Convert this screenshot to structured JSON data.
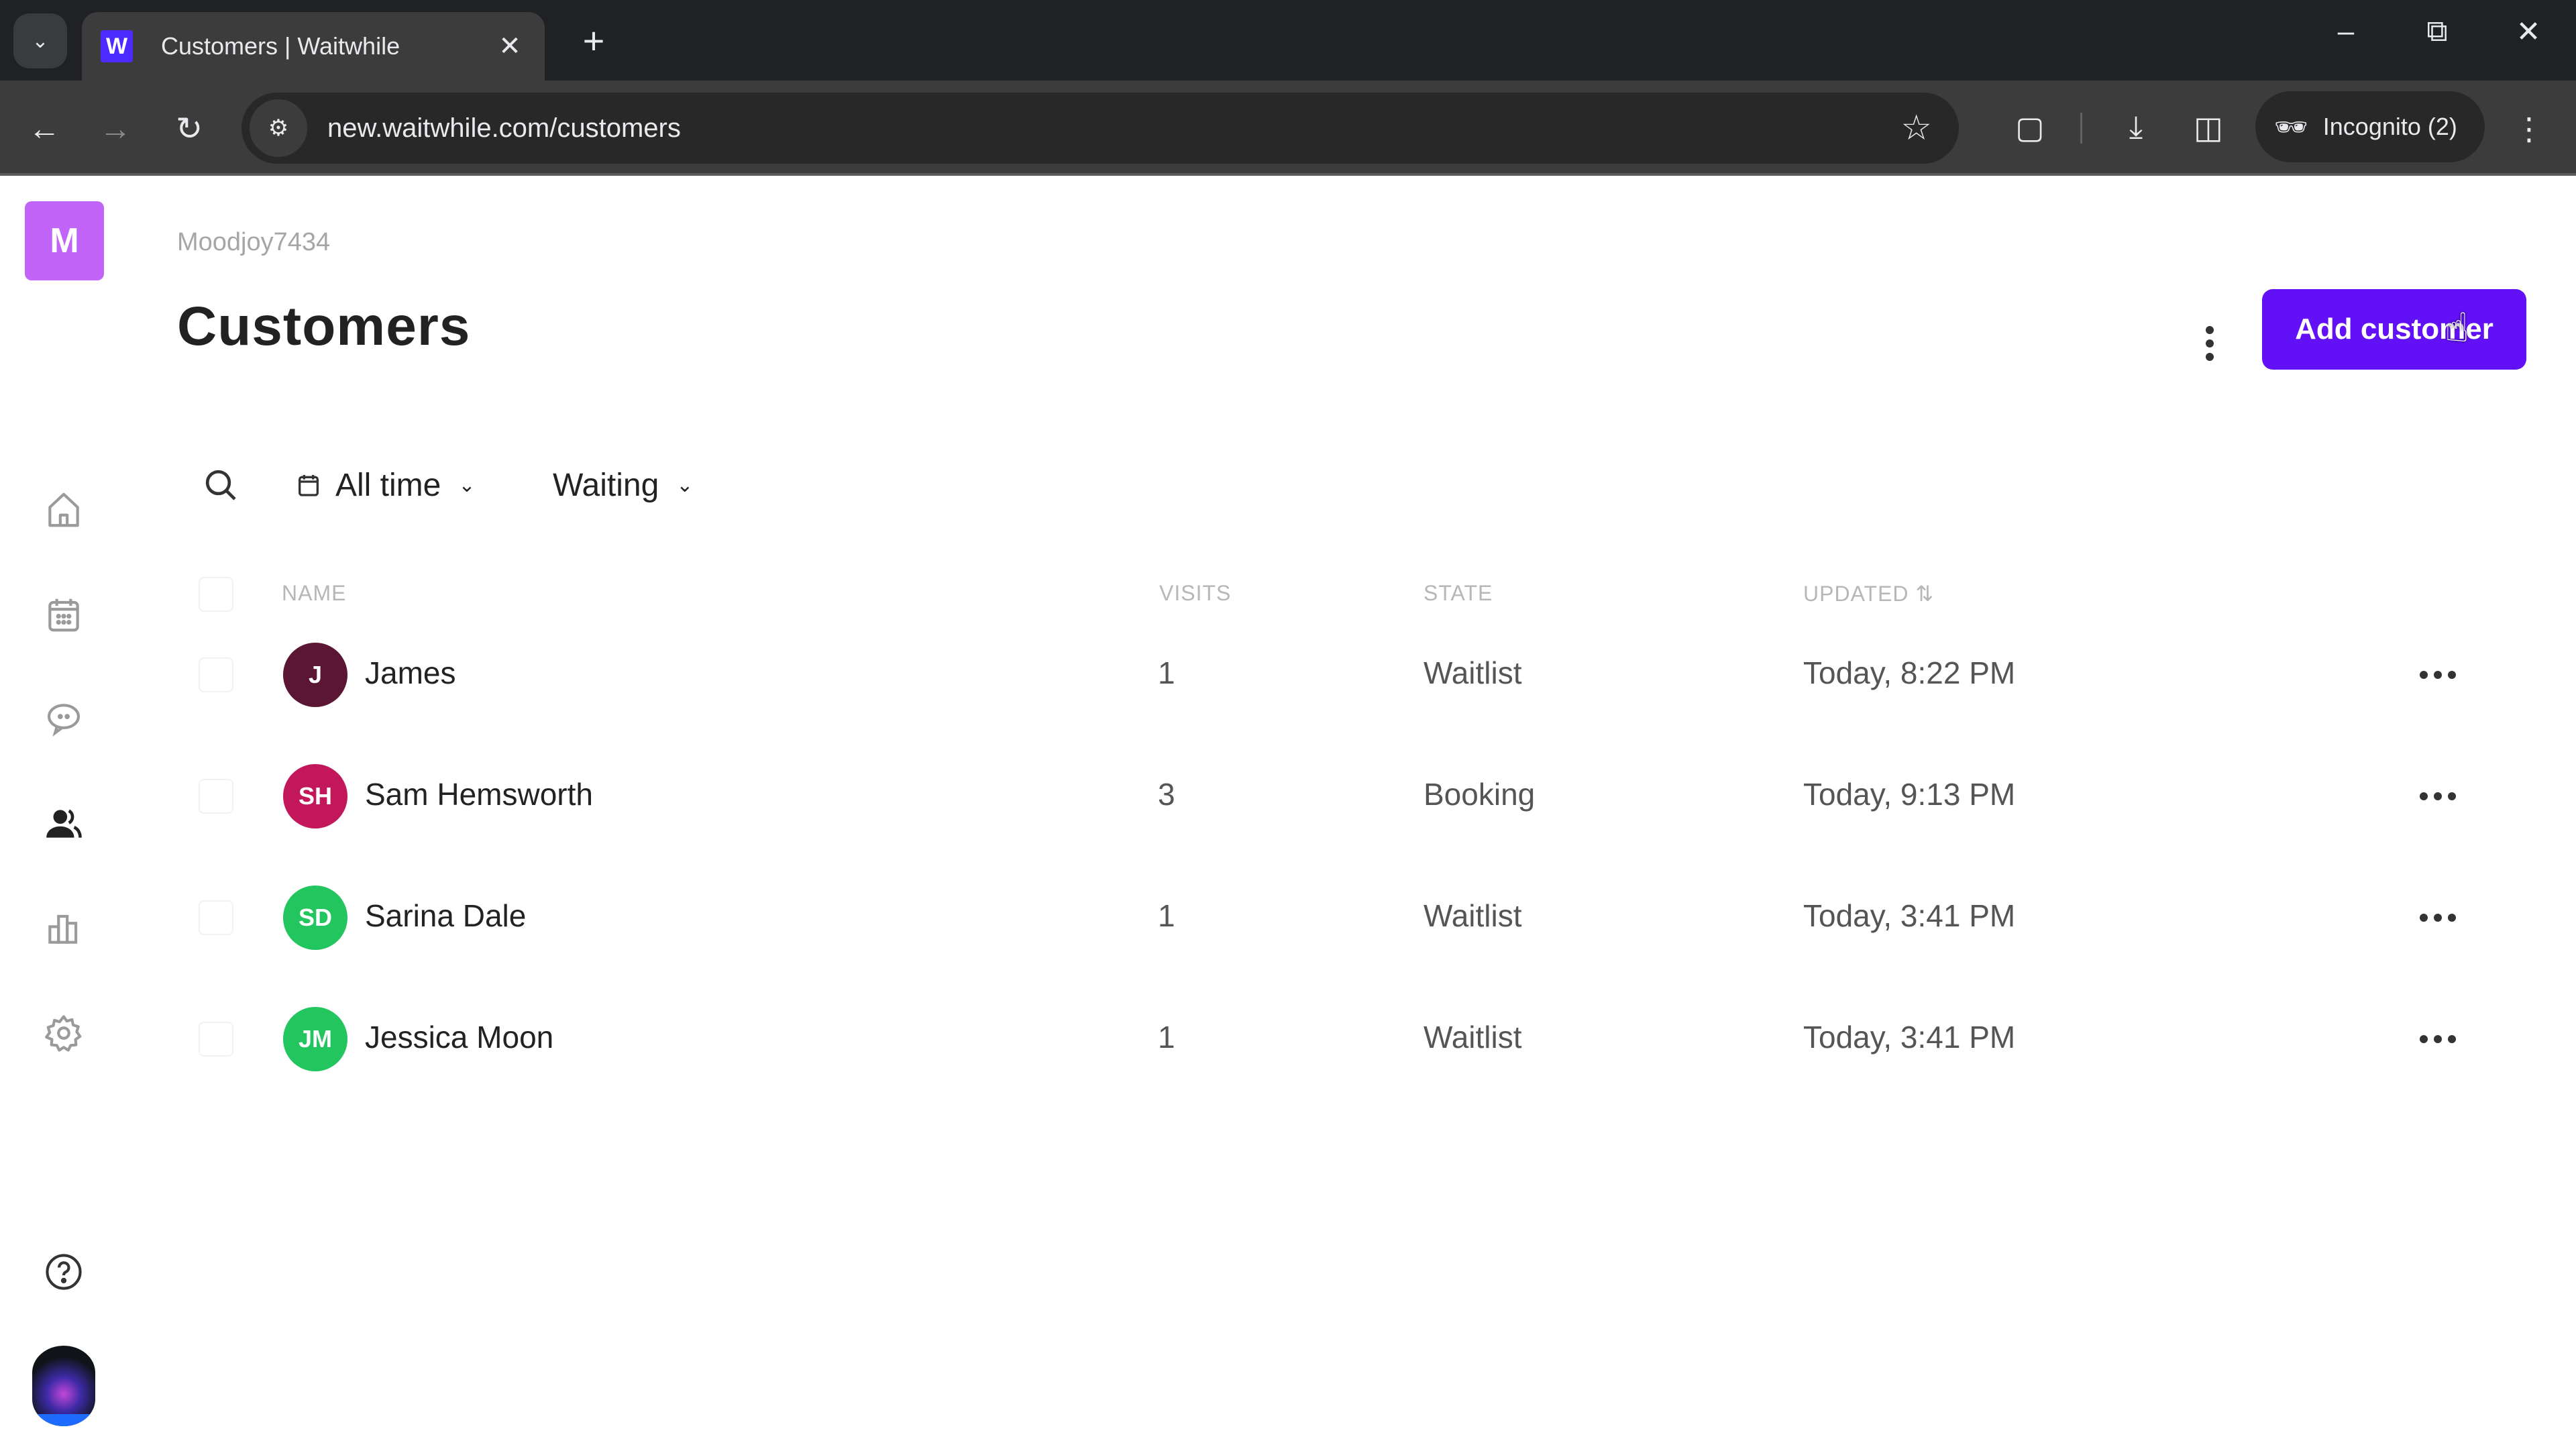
{
  "browser": {
    "tab_title": "Customers | Waitwhile",
    "favicon_letter": "W",
    "url": "new.waitwhile.com/customers",
    "incognito_label": "Incognito (2)"
  },
  "app": {
    "brand_letter": "M",
    "brand_color": "#c264f7",
    "accent_color": "#6210f5",
    "sidebar": {
      "items": [
        {
          "name": "home",
          "icon": "home-icon"
        },
        {
          "name": "calendar",
          "icon": "calendar-icon"
        },
        {
          "name": "messages",
          "icon": "chat-icon"
        },
        {
          "name": "customers",
          "icon": "users-icon",
          "active": true
        },
        {
          "name": "analytics",
          "icon": "bar-chart-icon"
        },
        {
          "name": "settings",
          "icon": "gear-icon"
        }
      ],
      "help_icon": "help-icon"
    },
    "workspace_name": "Moodjoy7434",
    "page_title": "Customers",
    "add_button_label": "Add customer",
    "filters": {
      "date_range": "All time",
      "status": "Waiting"
    },
    "table": {
      "columns": [
        "NAME",
        "VISITS",
        "STATE",
        "UPDATED"
      ],
      "sort_indicator": "⇅",
      "rows": [
        {
          "initials": "J",
          "avatar_color": "#5b1634",
          "name": "James",
          "visits": "1",
          "state": "Waitlist",
          "updated": "Today, 8:22 PM"
        },
        {
          "initials": "SH",
          "avatar_color": "#c2185b",
          "name": "Sam Hemsworth",
          "visits": "3",
          "state": "Booking",
          "updated": "Today, 9:13 PM"
        },
        {
          "initials": "SD",
          "avatar_color": "#22c55e",
          "name": "Sarina Dale",
          "visits": "1",
          "state": "Waitlist",
          "updated": "Today, 3:41 PM"
        },
        {
          "initials": "JM",
          "avatar_color": "#22c55e",
          "name": "Jessica Moon",
          "visits": "1",
          "state": "Waitlist",
          "updated": "Today, 3:41 PM"
        }
      ]
    }
  }
}
